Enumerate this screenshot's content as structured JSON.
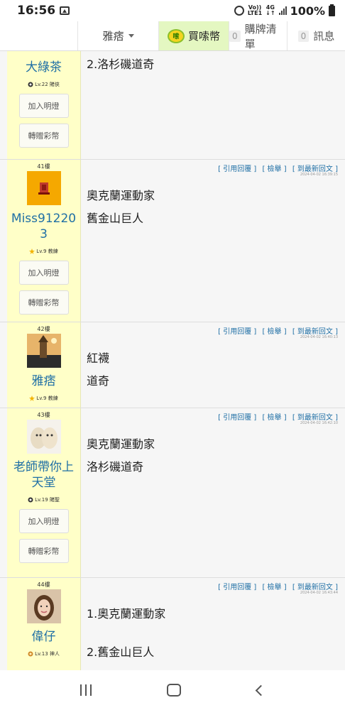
{
  "status": {
    "time": "16:56",
    "network_top": "Vo))",
    "network_bottom": "LTE1",
    "net_gen": "4G",
    "net_arrows": "↓↑",
    "battery": "100%"
  },
  "nav": {
    "user": "雅痞",
    "buy_label": "買嗦幣",
    "coin_text": "嗦",
    "cart_count": "0",
    "cart_label": "購牌清單",
    "msg_count": "0",
    "msg_label": "訊息"
  },
  "action_labels": {
    "quote": "[ 引用回覆 ]",
    "report": "[ 檢舉 ]",
    "latest": "[ 到最新回文 ]"
  },
  "side_buttons": {
    "light": "加入明燈",
    "gift": "轉贈彩幣"
  },
  "posts": [
    {
      "floor": "",
      "user": "大綠茶",
      "level": "Lv.22 賭俠",
      "timestamp": "",
      "lines": [
        "2.洛杉磯道奇"
      ]
    },
    {
      "floor": "41樓",
      "user": "Miss912203",
      "level": "Lv.9 教練",
      "timestamp": "2024-04-02 16:39:15",
      "lines": [
        "奧克蘭運動家",
        "舊金山巨人"
      ]
    },
    {
      "floor": "42樓",
      "user": "雅痞",
      "level": "Lv.9 教練",
      "timestamp": "2024-04-02 16:40:13",
      "lines": [
        "紅襪",
        "道奇"
      ]
    },
    {
      "floor": "43樓",
      "user": "老師帶你上天堂",
      "level": "Lv.19 賭聖",
      "timestamp": "2024-04-02 16:42:10",
      "lines": [
        "奧克蘭運動家",
        "洛杉磯道奇"
      ]
    },
    {
      "floor": "44樓",
      "user": "偉仔",
      "level": "Lv.13 神人",
      "timestamp": "2024-04-02 16:43:44",
      "lines": [
        "1.奧克蘭運動家",
        "2.舊金山巨人"
      ]
    }
  ]
}
